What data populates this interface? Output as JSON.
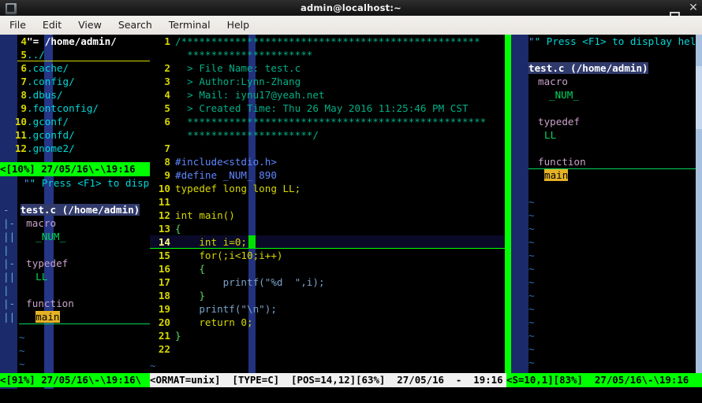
{
  "window": {
    "title": "admin@localhost:~",
    "icon": "terminal-icon",
    "buttons": {
      "minimize": "–",
      "maximize": "□",
      "close": "✕"
    }
  },
  "menubar": {
    "items": [
      "File",
      "Edit",
      "View",
      "Search",
      "Terminal",
      "Help"
    ]
  },
  "nerdtree": {
    "lines": [
      {
        "num": "4",
        "name": "\"= /home/admin/",
        "type": "header"
      },
      {
        "num": "5",
        "name": "../",
        "type": "dir"
      },
      {
        "num": "6",
        "name": ".cache/",
        "type": "dir"
      },
      {
        "num": "7",
        "name": ".config/",
        "type": "dir"
      },
      {
        "num": "8",
        "name": ".dbus/",
        "type": "dir"
      },
      {
        "num": "9",
        "name": ".fontconfig/",
        "type": "dir"
      },
      {
        "num": "10",
        "name": ".gconf/",
        "type": "dir"
      },
      {
        "num": "11",
        "name": ".gconfd/",
        "type": "dir"
      },
      {
        "num": "12",
        "name": ".gnome2/",
        "type": "dir"
      }
    ],
    "status": "<[10%] 27/05/16\\-\\19:16"
  },
  "tagbar_left": {
    "help": "\" Press <F1> to disp",
    "file": "test.c (/home/admin)",
    "sections": [
      {
        "fold": "-",
        "kind": "macro",
        "tag": "_NUM_",
        "highlight": false
      },
      {
        "fold": "-",
        "kind": "typedef",
        "tag": "LL",
        "highlight": false
      },
      {
        "fold": "-",
        "kind": "function",
        "tag": "main",
        "highlight": true
      }
    ],
    "tildes": [
      "~",
      "~",
      "~"
    ],
    "status": "<[91%] 27/05/16\\-\\19:16\\"
  },
  "editor": {
    "lines": [
      {
        "num": "1",
        "text": "/**************************************************"
      },
      {
        "num": "",
        "text": "  *********************"
      },
      {
        "num": "2",
        "text": "  > File Name: test.c"
      },
      {
        "num": "3",
        "text": "  > Author:Lynn-Zhang"
      },
      {
        "num": "4",
        "text": "  > Mail: iynu17@yeah.net"
      },
      {
        "num": "5",
        "text": "  > Created Time: Thu 26 May 2016 11:25:46 PM CST"
      },
      {
        "num": "6",
        "text": "  **************************************************"
      },
      {
        "num": "",
        "text": "  *********************/"
      },
      {
        "num": "7",
        "text": ""
      },
      {
        "num": "8",
        "text": "#include<stdio.h>"
      },
      {
        "num": "9",
        "text": "#define _NUM_ 890"
      },
      {
        "num": "10",
        "text": "typedef long long LL;"
      },
      {
        "num": "11",
        "text": ""
      },
      {
        "num": "12",
        "text": "int main()"
      },
      {
        "num": "13",
        "text": "{"
      },
      {
        "num": "14",
        "text": "    int i=0;"
      },
      {
        "num": "15",
        "text": "    for(;i<10;i++)"
      },
      {
        "num": "16",
        "text": "    {"
      },
      {
        "num": "17",
        "text": "        printf(\"%d  \",i);"
      },
      {
        "num": "18",
        "text": "    }"
      },
      {
        "num": "19",
        "text": "    printf(\"\\n\");"
      },
      {
        "num": "20",
        "text": "    return 0;"
      },
      {
        "num": "21",
        "text": "}"
      },
      {
        "num": "22",
        "text": ""
      }
    ],
    "current_line": "14",
    "tilde": "~",
    "status": "<ORMAT=unix]  [TYPE=C]  [POS=14,12][63%]  27/05/16  -  19:16"
  },
  "tagbar_right": {
    "help": "\" Press <F1> to display hel",
    "file": "test.c (/home/admin)",
    "sections": [
      {
        "kind": "macro",
        "tag": "_NUM_",
        "highlight": false
      },
      {
        "kind": "typedef",
        "tag": "LL",
        "highlight": false
      },
      {
        "kind": "function",
        "tag": "main",
        "highlight": true
      }
    ],
    "tilde": "~",
    "status": "<S=10,1][83%]  27/05/16\\-\\19:16"
  },
  "colors": {
    "accent_green": "#00ff00",
    "gutter_blue": "#1b2a6b",
    "tag_highlight": "#e5b225",
    "comment": "#00af87",
    "linenumber": "#d7d700"
  }
}
